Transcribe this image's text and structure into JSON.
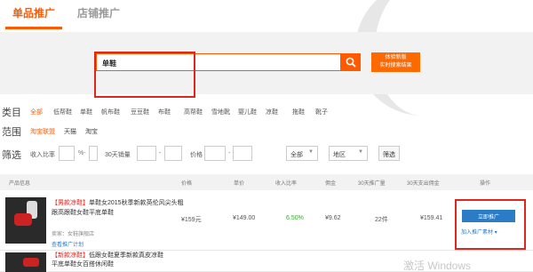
{
  "tabs": [
    "单品推广",
    "店铺推广"
  ],
  "search": {
    "value": "单鞋",
    "orange_button": [
      "体验新版",
      "实时搜索结果"
    ]
  },
  "filters": {
    "category_label": "类目",
    "categories": [
      "全部",
      "低帮鞋",
      "单鞋",
      "帆布鞋",
      "豆豆鞋",
      "布鞋",
      "高帮鞋",
      "雪地靴",
      "婴儿鞋",
      "凉鞋",
      "拖鞋",
      "靴子"
    ],
    "range_label": "范围",
    "ranges": [
      "淘宝联盟",
      "天猫",
      "淘宝"
    ],
    "condition_label": "筛选",
    "income_label": "收入比率",
    "sales_label": "30天销量",
    "price_label": "价格",
    "sort_select": "全部",
    "region_select": "地区",
    "filter_button": "筛选"
  },
  "table": {
    "headers": [
      "产品信息",
      "价格",
      "单价",
      "收入比率",
      "佣金",
      "30天推广量",
      "30天支出佣金",
      "操作"
    ],
    "rows": [
      {
        "tag": "【男款凉鞋】",
        "title": "单鞋女2015秋季新款英伦风尖头粗跟高跟鞋女鞋平底单鞋",
        "shop": "卖家：女鞋旗舰店",
        "plan": "查看推广计划",
        "price": "¥159元",
        "unit_price": "¥149.00",
        "rate": "6.50%",
        "commission": "¥9.62",
        "volume": "22件",
        "spent": "¥159.41",
        "promote": "立即推广",
        "ops": "加入推广素材 ▾"
      },
      {
        "tag": "【新款凉鞋】",
        "title": "低跟女鞋夏季新款真皮凉鞋",
        "subtitle": "平底单鞋女百搭休闲鞋"
      }
    ]
  },
  "watermark": "激活 Windows"
}
